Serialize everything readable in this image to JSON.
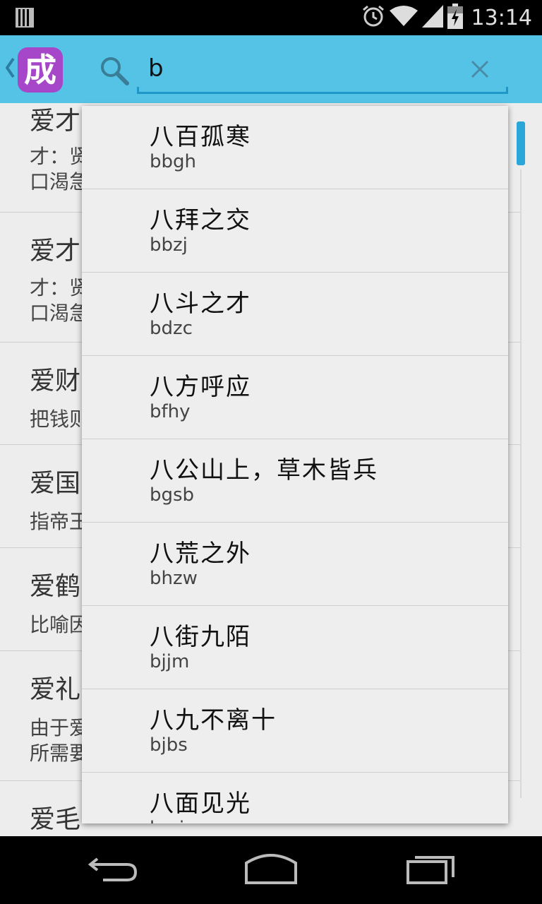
{
  "status_bar": {
    "time": "13:14",
    "icons": [
      "notification-icon",
      "alarm-icon",
      "wifi-icon",
      "signal-icon",
      "battery-icon"
    ]
  },
  "action_bar": {
    "app_icon_glyph": "成",
    "search": {
      "value": "b"
    }
  },
  "background_list": [
    {
      "title": "爱才",
      "desc": "才：贤\n口渴急"
    },
    {
      "title": "爱才",
      "desc": "才：贤\n口渴急"
    },
    {
      "title": "爱财",
      "desc": "把钱则"
    },
    {
      "title": "爱国",
      "desc": "指帝王"
    },
    {
      "title": "爱鹤",
      "desc": "比喻因"
    },
    {
      "title": "爱礼",
      "desc": "由于爱\n所需要"
    },
    {
      "title": "爱毛",
      "desc": ""
    }
  ],
  "suggestions": [
    {
      "word": "八百孤寒",
      "abbr": "bbgh"
    },
    {
      "word": "八拜之交",
      "abbr": "bbzj"
    },
    {
      "word": "八斗之才",
      "abbr": "bdzc"
    },
    {
      "word": "八方呼应",
      "abbr": "bfhy"
    },
    {
      "word": "八公山上，草木皆兵",
      "abbr": "bgsb"
    },
    {
      "word": "八荒之外",
      "abbr": "bhzw"
    },
    {
      "word": "八街九陌",
      "abbr": "bjjm"
    },
    {
      "word": "八九不离十",
      "abbr": "bjbs"
    },
    {
      "word": "八面见光",
      "abbr": "bmjg"
    }
  ],
  "colors": {
    "action_bar": "#54c3e6",
    "accent": "#1f97c9",
    "app_icon": "#a547c8"
  }
}
